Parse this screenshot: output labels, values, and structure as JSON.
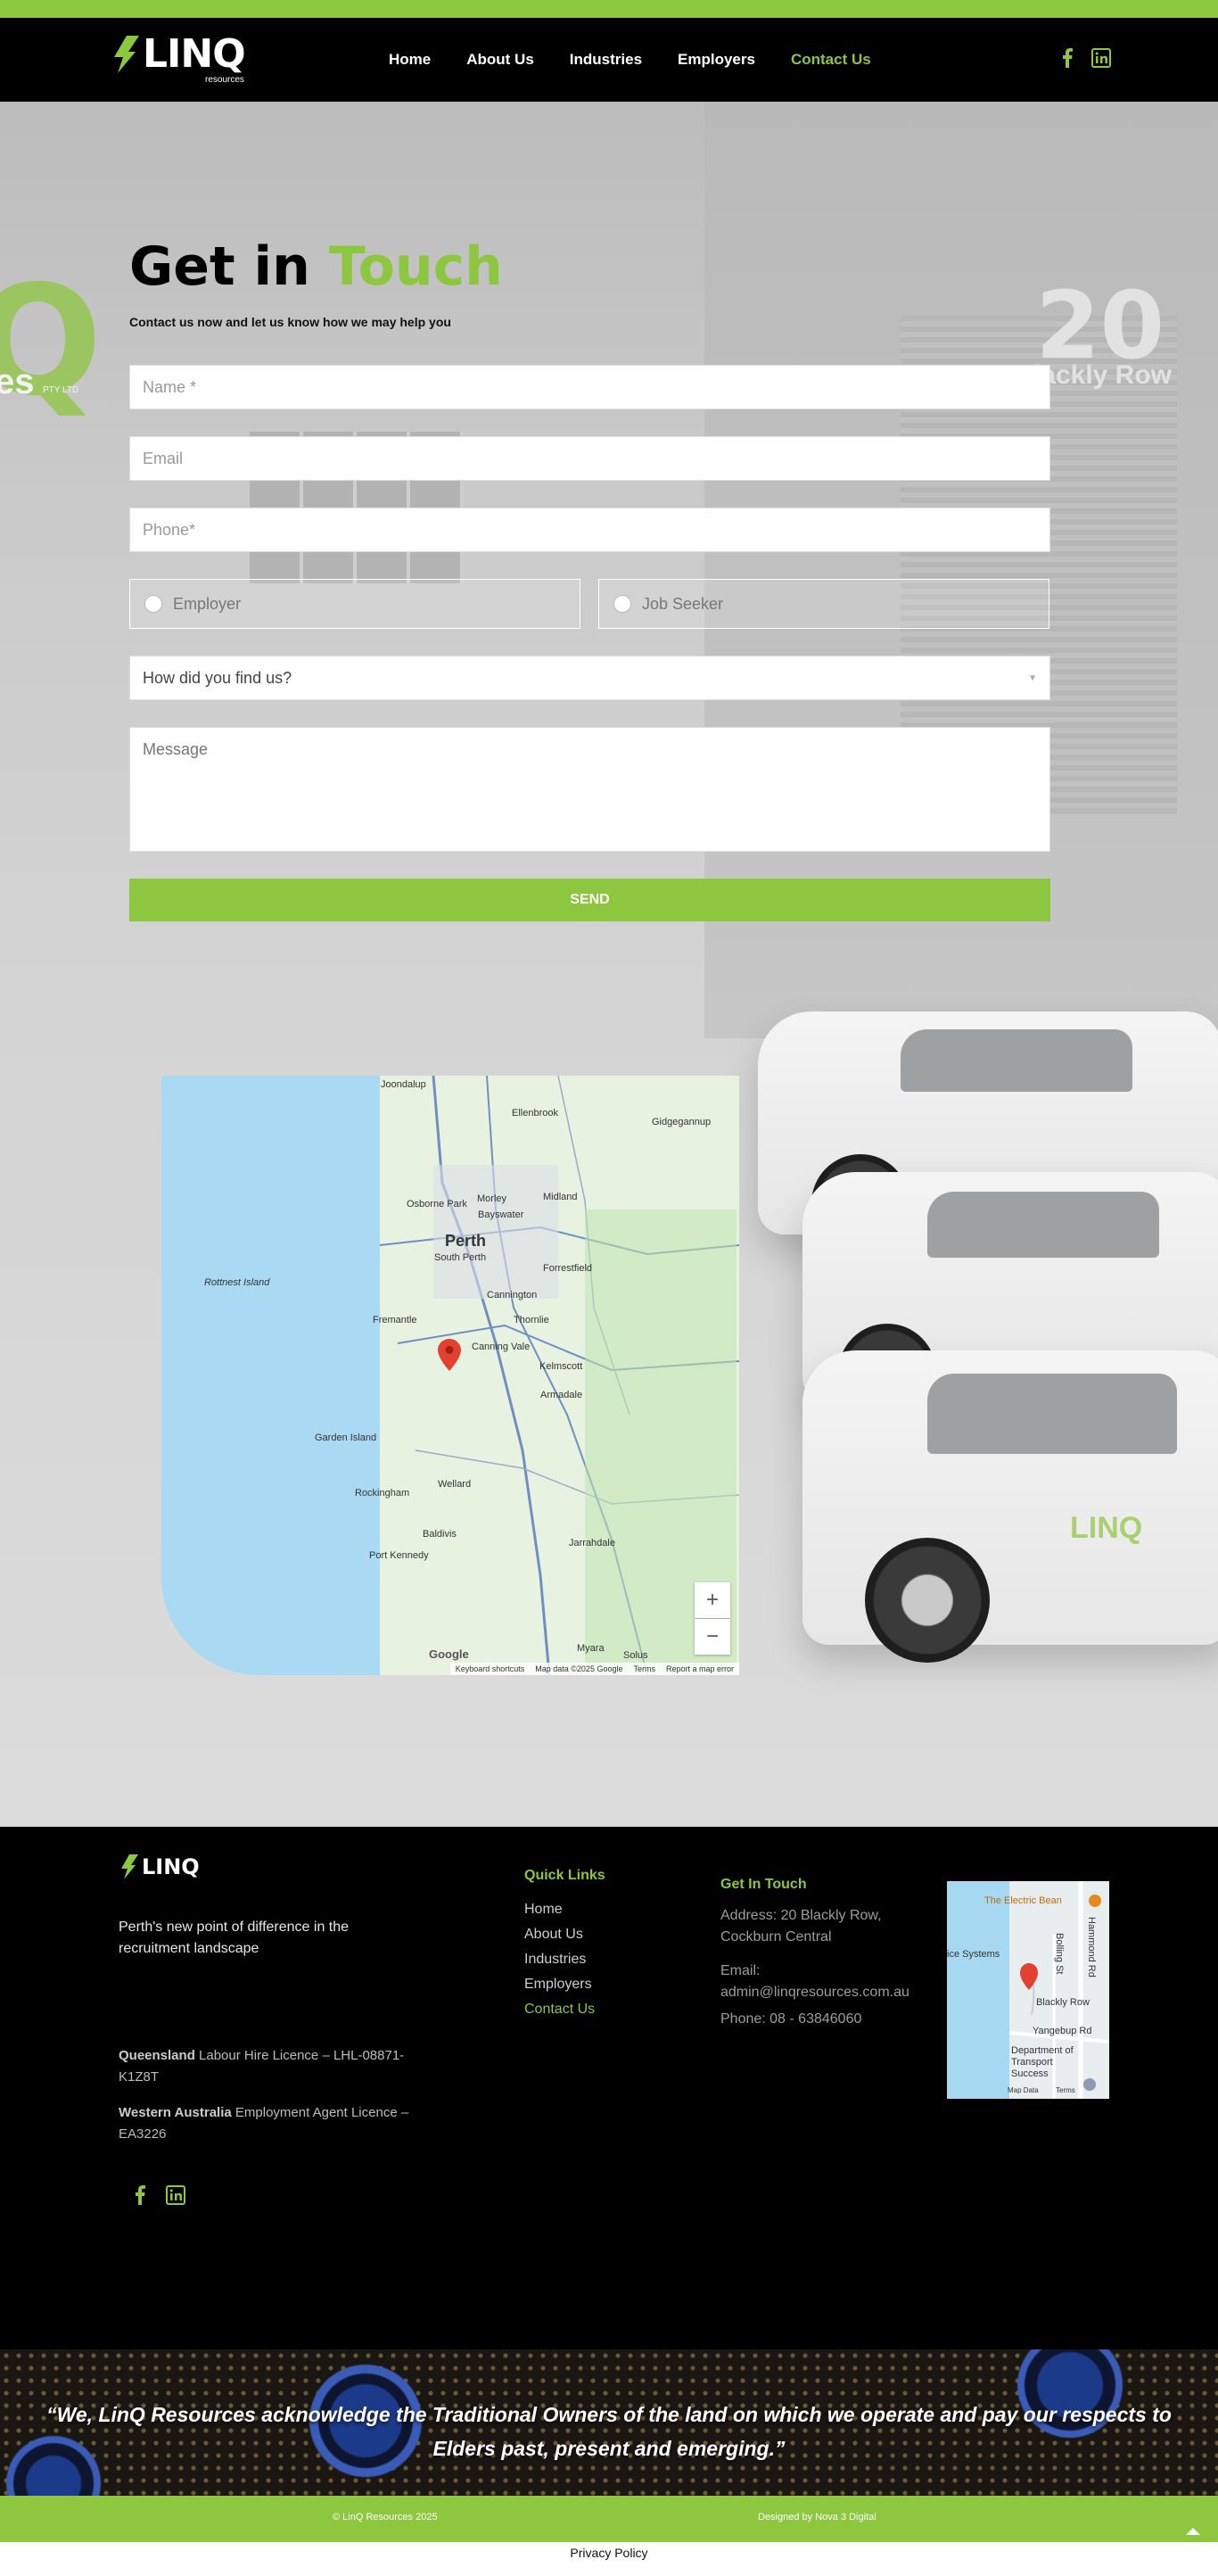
{
  "brand": {
    "logo_text": "LINQ",
    "logo_sub": "resources"
  },
  "nav": {
    "items": [
      {
        "label": "Home",
        "active": false
      },
      {
        "label": "About Us",
        "active": false
      },
      {
        "label": "Industries",
        "active": false
      },
      {
        "label": "Employers",
        "active": false
      },
      {
        "label": "Contact Us",
        "active": true
      }
    ]
  },
  "social": {
    "icons": [
      "facebook-icon",
      "linkedin-icon"
    ]
  },
  "hero_bg": {
    "building_number": "20",
    "building_street": "Blackly Row",
    "wall_sign_q": "Q",
    "wall_sign_es": "es",
    "wall_sign_pty": "PTY LTD",
    "car_label": "LINQ"
  },
  "form": {
    "title_part1": "Get in",
    "title_part2": "Touch",
    "subtitle": "Contact us now and let us know how we may help you",
    "name_placeholder": "Name *",
    "email_placeholder": "Email",
    "phone_placeholder": "Phone*",
    "radio_employer": "Employer",
    "radio_jobseeker": "Job Seeker",
    "select_value": "How did you find us?",
    "message_placeholder": "Message",
    "send_label": "SEND"
  },
  "map": {
    "city": "Perth",
    "labels": [
      "Joondalup",
      "Ellenbrook",
      "Gidgegannup",
      "Osborne Park",
      "Morley",
      "Bayswater",
      "Midland",
      "Rottnest Island",
      "South Perth",
      "Forrestfield",
      "Cannington",
      "Fremantle",
      "Thornlie",
      "Canning Vale",
      "Kelmscott",
      "Armadale",
      "Garden Island",
      "Rockingham",
      "Wellard",
      "Baldivis",
      "Jarrahdale",
      "Port Kennedy",
      "Myara",
      "Solus"
    ],
    "footer": [
      "Keyboard shortcuts",
      "Map data ©2025 Google",
      "Terms",
      "Report a map error"
    ],
    "google": "Google",
    "zoom_in": "+",
    "zoom_out": "−"
  },
  "footer": {
    "tagline": "Perth's new point of difference in the recruitment landscape",
    "licence_qld_bold": "Queensland",
    "licence_qld": "Labour Hire Licence – LHL-08871-K1Z8T",
    "licence_wa_bold": "Western Australia",
    "licence_wa": "Employment Agent Licence – EA3226",
    "quick_links_heading": "Quick Links",
    "quick_links": [
      {
        "label": "Home",
        "active": false
      },
      {
        "label": "About Us",
        "active": false
      },
      {
        "label": "Industries",
        "active": false
      },
      {
        "label": "Employers",
        "active": false
      },
      {
        "label": "Contact Us",
        "active": true
      }
    ],
    "get_in_touch_heading": "Get In Touch",
    "address": "Address: 20 Blackly Row, Cockburn Central",
    "email": "Email: admin@linqresources.com.au",
    "phone": "Phone: 08 - 63846060",
    "small_map_labels": [
      "The Electric Bean",
      "Blackly Row",
      "Yangebup Rd",
      "Department of Transport Success",
      "Bolling St",
      "Hammond Rd",
      "ice Systems",
      "Map Data",
      "Terms"
    ]
  },
  "acknowledgement": "“We, LinQ Resources acknowledge the Traditional Owners of the land on which we operate and pay our respects to Elders past, present and emerging.”",
  "bottom": {
    "copyright": "© LinQ Resources 2025",
    "designed_by": "Designed by Nova 3 Digital"
  },
  "privacy": "Privacy Policy",
  "colors": {
    "accent": "#8dc63f",
    "header_bg": "#000000"
  }
}
